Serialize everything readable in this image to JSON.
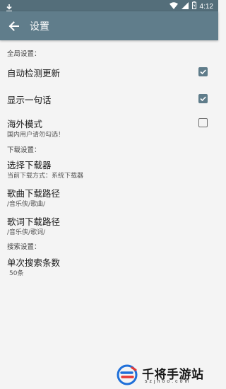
{
  "status_bar": {
    "time": "4:12",
    "icons": [
      "download-icon",
      "wifi-icon",
      "signal-icon",
      "battery-icon"
    ]
  },
  "app_bar": {
    "title": "设置",
    "back_icon": "arrow-back-icon"
  },
  "sections": {
    "global": {
      "header": "全局设置：",
      "auto_update": {
        "title": "自动检测更新",
        "checked": true
      },
      "show_quote": {
        "title": "显示一句话",
        "checked": true
      },
      "overseas": {
        "title": "海外模式",
        "summary": "国内用户请勿勾选！",
        "checked": false
      }
    },
    "download": {
      "header": "下载设置：",
      "downloader": {
        "title": "选择下载器",
        "summary": "当前下载方式：系统下载器"
      },
      "song_path": {
        "title": "歌曲下载路径",
        "summary": "/音乐侠/歌曲/"
      },
      "lyrics_path": {
        "title": "歌词下载路径",
        "summary": "/音乐侠/歌词/"
      }
    },
    "search": {
      "header": "搜索设置：",
      "result_count": {
        "title": "单次搜索条数",
        "summary": "50条"
      }
    }
  },
  "watermark": {
    "title": "千将手游站",
    "subtitle": "szjhoo.com"
  },
  "colors": {
    "status_bar": "#546e7a",
    "app_bar": "#607d8b",
    "accent": "#5f7c8a",
    "background": "#f4f4f4"
  }
}
